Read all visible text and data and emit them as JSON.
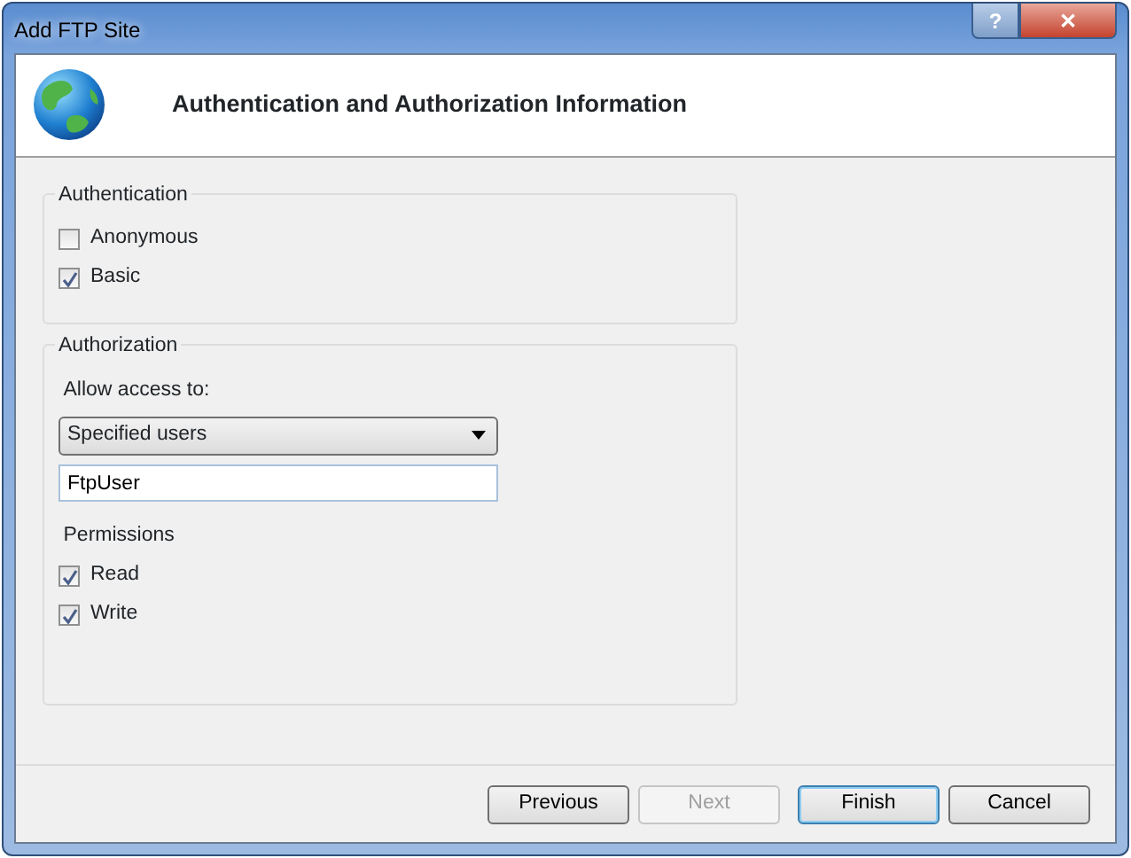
{
  "window": {
    "title": "Add FTP Site",
    "caption_buttons": [
      {
        "kind": "help",
        "label": "?"
      },
      {
        "kind": "close",
        "label": "✕"
      }
    ]
  },
  "header": {
    "title": "Authentication and Authorization Information"
  },
  "authentication": {
    "title": "Authentication",
    "options": [
      {
        "label": "Anonymous",
        "checked": false
      },
      {
        "label": "Basic",
        "checked": true
      }
    ]
  },
  "authorization": {
    "title": "Authorization",
    "access_label": "Allow access to:",
    "access_value": "Specified users",
    "users_value": "FtpUser",
    "permissions_label": "Permissions",
    "permissions": [
      {
        "label": "Read",
        "checked": true
      },
      {
        "label": "Write",
        "checked": true
      }
    ]
  },
  "buttons": [
    {
      "label": "Previous",
      "disabled": false,
      "default": false
    },
    {
      "label": "Next",
      "disabled": true,
      "default": false
    },
    {
      "label": "Finish",
      "disabled": false,
      "default": true
    },
    {
      "label": "Cancel",
      "disabled": false,
      "default": false
    }
  ]
}
